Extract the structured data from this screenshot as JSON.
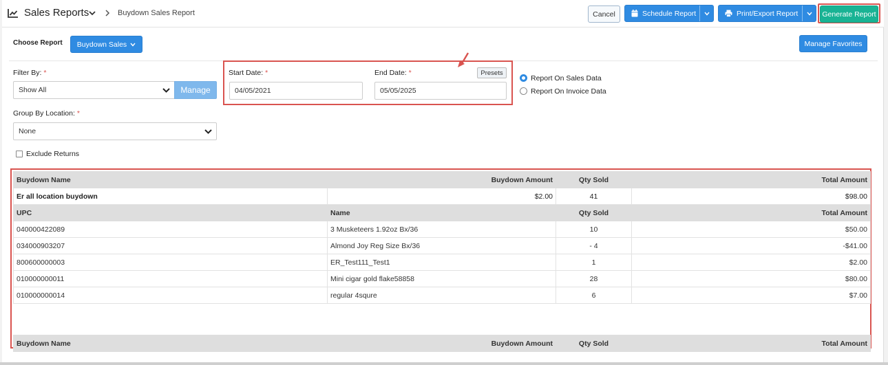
{
  "header": {
    "title": "Sales Reports",
    "breadcrumb": "Buydown Sales Report",
    "cancel_label": "Cancel",
    "schedule_label": "Schedule Report",
    "print_label": "Print/Export Report",
    "generate_label": "Generate Report"
  },
  "report": {
    "choose_label": "Choose Report",
    "selected": "Buydown Sales",
    "favorites_label": "Manage Favorites"
  },
  "filters": {
    "filter_by_label": "Filter By:",
    "filter_by_value": "Show All",
    "manage_label": "Manage",
    "group_by_label": "Group By Location:",
    "group_by_value": "None",
    "exclude_returns_label": "Exclude Returns",
    "required_mark": "*"
  },
  "dates": {
    "start_label": "Start Date:",
    "start_value": "04/05/2021",
    "end_label": "End Date:",
    "end_value": "05/05/2025",
    "presets_label": "Presets"
  },
  "data_source": {
    "options": [
      "Report On Sales Data",
      "Report On Invoice Data"
    ],
    "selected": "Report On Sales Data"
  },
  "table": {
    "header": [
      "Buydown Name",
      "Buydown Amount",
      "Qty Sold",
      "Total Amount"
    ],
    "group": {
      "name": "Er all location buydown",
      "amount": "$2.00",
      "qty": "41",
      "total": "$98.00"
    },
    "sub_header": [
      "UPC",
      "Name",
      "Qty Sold",
      "Total Amount"
    ],
    "rows": [
      {
        "upc": "040000422089",
        "name": "3 Musketeers 1.92oz Bx/36",
        "qty": "10",
        "total": "$50.00"
      },
      {
        "upc": "034000903207",
        "name": "Almond Joy Reg Size Bx/36",
        "qty": "- 4",
        "total": "-$41.00"
      },
      {
        "upc": "800600000003",
        "name": "ER_Test111_Test1",
        "qty": "1",
        "total": "$2.00"
      },
      {
        "upc": "010000000011",
        "name": "Mini cigar gold flake58858",
        "qty": "28",
        "total": "$80.00"
      },
      {
        "upc": "010000000014",
        "name": "regular 4squre",
        "qty": "6",
        "total": "$7.00"
      }
    ],
    "footer_header": [
      "Buydown Name",
      "Buydown Amount",
      "Qty Sold",
      "Total Amount"
    ]
  },
  "colors": {
    "primary": "#2f8be2",
    "generate": "#19b394",
    "highlight": "#d9534f"
  }
}
